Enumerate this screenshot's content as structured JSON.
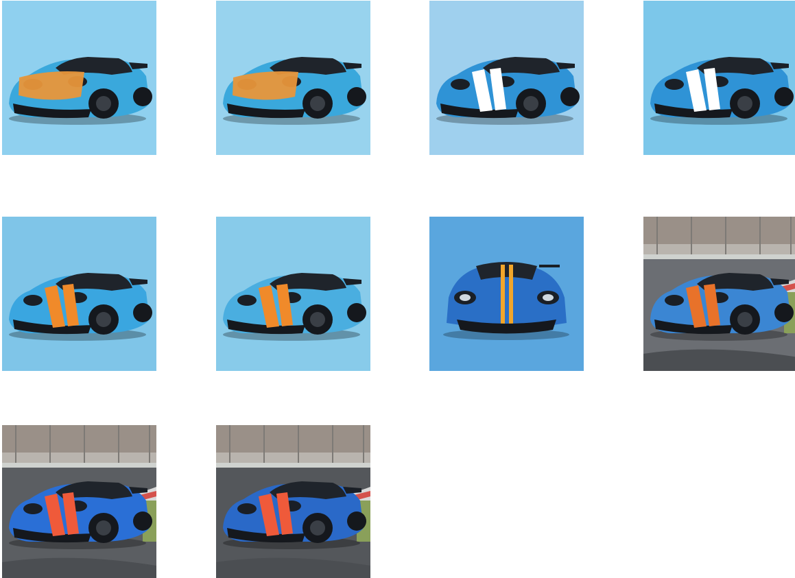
{
  "images": [
    {
      "scene": "studio",
      "bg": "#8fd0ef",
      "body": "#3aa8dc",
      "stripe": "#e8963a",
      "view": "front-three-quarter",
      "stripe_style": "hood-wide"
    },
    {
      "scene": "studio",
      "bg": "#98d3ee",
      "body": "#3aa8dc",
      "stripe": "#e8963a",
      "view": "front-three-quarter",
      "stripe_style": "hood-wide"
    },
    {
      "scene": "studio",
      "bg": "#9fd0ee",
      "body": "#2f93d6",
      "stripe": "#ffffff",
      "view": "front-three-quarter",
      "stripe_style": "twin"
    },
    {
      "scene": "studio",
      "bg": "#7cc7ea",
      "body": "#2f93d6",
      "stripe": "#ffffff",
      "view": "front-three-quarter",
      "stripe_style": "twin"
    },
    {
      "scene": "studio",
      "bg": "#7fc5e8",
      "body": "#3aa6e0",
      "stripe": "#f08a2a",
      "view": "front-three-quarter",
      "stripe_style": "twin"
    },
    {
      "scene": "studio",
      "bg": "#88cbea",
      "body": "#4aaee0",
      "stripe": "#f08a2a",
      "view": "front-three-quarter",
      "stripe_style": "twin"
    },
    {
      "scene": "studio",
      "bg": "#5aa6de",
      "body": "#2a6fc6",
      "stripe": "#f2a62a",
      "view": "front",
      "stripe_style": "twin"
    },
    {
      "scene": "track",
      "bg": "#6b6e73",
      "body": "#3b86d3",
      "stripe": "#e8722a",
      "view": "front-three-quarter",
      "stripe_style": "twin"
    },
    {
      "scene": "track",
      "bg": "#5b5e62",
      "body": "#2a6fd6",
      "stripe": "#ef5a3a",
      "view": "front-three-quarter",
      "stripe_style": "twin"
    },
    {
      "scene": "track",
      "bg": "#54575b",
      "body": "#2a69c8",
      "stripe": "#ef5a3a",
      "view": "front-three-quarter",
      "stripe_style": "twin"
    }
  ]
}
